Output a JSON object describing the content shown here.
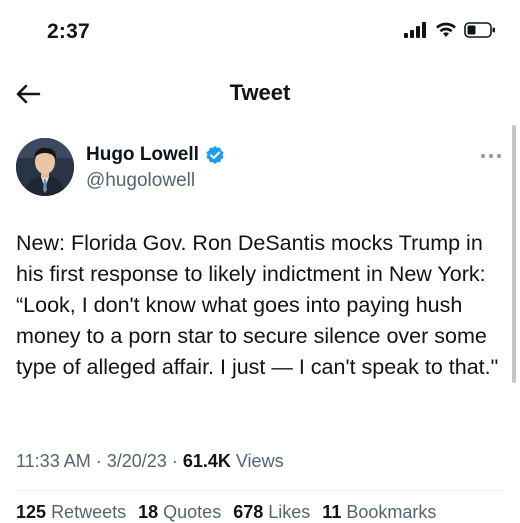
{
  "status_bar": {
    "time": "2:37"
  },
  "nav": {
    "title": "Tweet"
  },
  "author": {
    "name": "Hugo Lowell",
    "handle": "@hugolowell",
    "verified_color": "#1d9bf0"
  },
  "tweet": {
    "text": "New: Florida Gov. Ron DeSantis mocks Trump in his first response to likely indictment in New York: “Look, I don't know what goes into paying hush money to a porn star to secure silence over some type of alleged affair. I just — I can't speak to that.\"",
    "time": "11:33 AM",
    "date": "3/20/23",
    "views_count": "61.4K",
    "views_label": "Views"
  },
  "stats": {
    "retweets_count": "125",
    "retweets_label": "Retweets",
    "quotes_count": "18",
    "quotes_label": "Quotes",
    "likes_count": "678",
    "likes_label": "Likes",
    "bookmarks_count": "11",
    "bookmarks_label": "Bookmarks"
  },
  "colors": {
    "text": "#0f1419",
    "secondary": "#536471",
    "accent": "#1d9bf0"
  },
  "icons": {
    "back": "arrow-left-icon",
    "verified": "verified-badge-icon",
    "more": "more-options-icon",
    "signal": "cellular-signal-icon",
    "wifi": "wifi-icon",
    "battery": "battery-icon"
  }
}
